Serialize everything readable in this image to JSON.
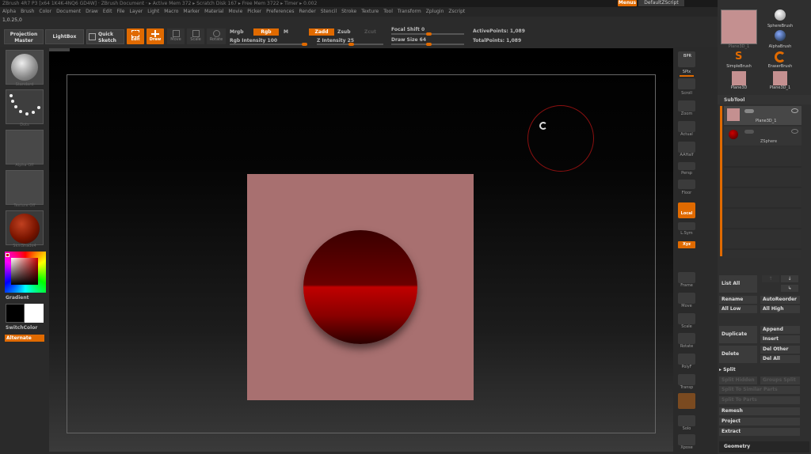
{
  "title_bar": {
    "text": "ZBrush 4R7 P3 [x64 1K4K-4NQ6 GD4W] · ZBrush Document · ▸ Active Mem 372 ▸ Scratch Disk 167 ▸ Free Mem 3722 ▸ Timer ▸ 0.002"
  },
  "menu": {
    "items": [
      "Alpha",
      "Brush",
      "Color",
      "Document",
      "Draw",
      "Edit",
      "File",
      "Layer",
      "Light",
      "Macro",
      "Marker",
      "Material",
      "Movie",
      "Picker",
      "Preferences",
      "Render",
      "Stencil",
      "Stroke",
      "Texture",
      "Tool",
      "Transform",
      "Zplugin",
      "Zscript"
    ],
    "menus_label": "Menus",
    "script_label": "DefaultZScript"
  },
  "coord": "1,0.25,0",
  "toolbar": {
    "projection_master": "Projection Master",
    "lightbox": "LightBox",
    "quick_sketch": "Quick Sketch",
    "edit": "Edit",
    "draw": "Draw",
    "move": "Move",
    "scale": "Scale",
    "rotate": "Rotate",
    "mrgb": "Mrgb",
    "rgb": "Rgb",
    "m": "M",
    "rgb_intensity_label": "Rgb Intensity",
    "rgb_intensity_value": "100",
    "rgb_intensity_level": 1.0,
    "zadd": "Zadd",
    "zsub": "Zsub",
    "zcut": "Zcut",
    "z_intensity_label": "Z Intensity",
    "z_intensity_value": "25",
    "z_intensity_level": 0.25,
    "focal_shift_label": "Focal Shift",
    "focal_shift_value": "0",
    "draw_size_label": "Draw Size",
    "draw_size_value": "64",
    "active_points_label": "ActivePoints:",
    "active_points_value": "1,089",
    "total_points_label": "TotalPoints:",
    "total_points_value": "1,089"
  },
  "left_panel": {
    "standard": "Standard",
    "dots": "Dots",
    "alpha_off": "Alpha Off",
    "texture_off": "Texture Off",
    "material": "SkinShade4",
    "gradient": "Gradient",
    "switch_color": "SwitchColor",
    "alternate": "Alternate",
    "main_color": "#000000",
    "secondary_color": "#ffffff"
  },
  "right_strip": {
    "items": [
      "BPR",
      "SPix",
      "Scroll",
      "Zoom",
      "Actual",
      "AAHalf",
      "Persp",
      "Floor",
      "Local",
      "L.Sym",
      "Xyz",
      "",
      "Frame",
      "Move",
      "Scale",
      "Rotate",
      "PolyF",
      "Transp",
      "",
      "Solo",
      "Xpose"
    ]
  },
  "right_panel": {
    "tool_thumbs": [
      "Plane3D_1",
      "SphereBrush",
      "AlphaBrush",
      "SimpleBrush",
      "EraserBrush",
      "Plane3D",
      "Plane3D_1"
    ],
    "subtool_header": "SubTool",
    "subtools": [
      "Plane3D_1",
      "ZSphere"
    ],
    "list_all": "List All",
    "rename": "Rename",
    "auto_reorder": "AutoReorder",
    "all_low": "All Low",
    "all_high": "All High",
    "append": "Append",
    "duplicate": "Duplicate",
    "insert": "Insert",
    "delete": "Delete",
    "del_other": "Del Other",
    "del_all": "Del All",
    "split": "Split",
    "split_hidden": "Split Hidden",
    "groups_split": "Groups Split",
    "split_to_similar": "Split To Similar Parts",
    "split_to_parts": "Split To Parts",
    "remesh": "Remesh",
    "project": "Project",
    "extract": "Extract",
    "geometry": "Geometry"
  },
  "colors": {
    "accent": "#e06a00",
    "plane": "#a87070",
    "sphere": "#8a0000"
  }
}
